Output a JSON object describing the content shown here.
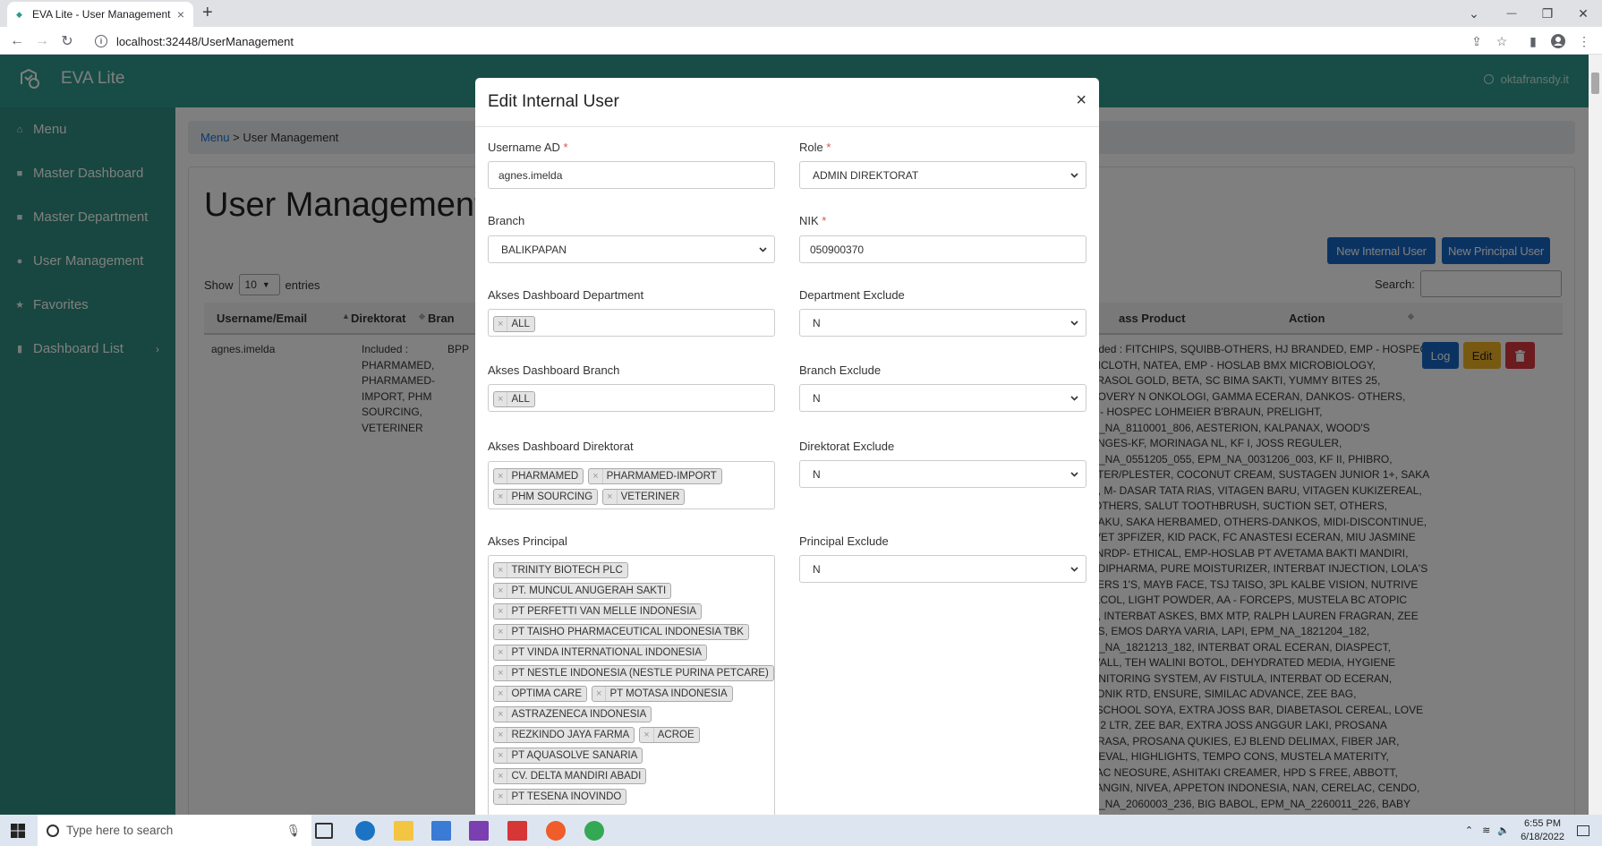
{
  "browser": {
    "tab_title": "EVA Lite - User Management",
    "tab_close": "×",
    "new_tab": "+",
    "url": "localhost:32448/UserManagement",
    "nav_back": "←",
    "nav_forward": "→",
    "nav_reload": "↻",
    "win_chevron": "⌄",
    "win_min": "—",
    "win_restore": "❐",
    "win_close": "✕"
  },
  "app": {
    "brand": "EVA Lite",
    "user": "oktafransdy.it",
    "accent_color": "#2e9b8c"
  },
  "sidebar": {
    "items": [
      {
        "label": "Menu",
        "icon": "home-icon",
        "glyph": "⌂"
      },
      {
        "label": "Master Dashboard",
        "icon": "database-icon",
        "glyph": "■"
      },
      {
        "label": "Master Department",
        "icon": "database-icon",
        "glyph": "■"
      },
      {
        "label": "User Management",
        "icon": "user-icon",
        "glyph": "●"
      },
      {
        "label": "Favorites",
        "icon": "star-icon",
        "glyph": "★"
      },
      {
        "label": "Dashboard List",
        "icon": "file-icon",
        "glyph": "▮",
        "arrow": "›"
      }
    ]
  },
  "breadcrumb": {
    "root": "Menu",
    "sep": " > ",
    "current": "User Management"
  },
  "page": {
    "title": "User Management",
    "new_internal_label": "New Internal User",
    "new_principal_label": "New Principal User",
    "show_label": "Show",
    "entries_value": "10",
    "entries_label": "entries",
    "search_label": "Search:"
  },
  "table": {
    "headers": {
      "username": "Username/Email",
      "direktorat": "Direktorat",
      "branch": "Bran",
      "product": "ass Product",
      "action": "Action"
    },
    "row": {
      "username": "agnes.imelda",
      "direktorat": [
        "Included :",
        "PHARMAMED,",
        "PHARMAMED-",
        "IMPORT, PHM",
        "SOURCING,",
        "VETERINER"
      ],
      "branch": "BPP",
      "product": [
        "luded : FITCHIPS, SQUIBB-OTHERS, HJ BRANDED, EMP - HOSPEC",
        "DICLOTH, NATEA, EMP - HOSLAB BMX MICROBIOLOGY,",
        "TRASOL GOLD, BETA, SC BIMA SAKTI, YUMMY BITES 25,",
        "COVERY N ONKOLOGI, GAMMA ECERAN, DANKOS- OTHERS,",
        "P - HOSPEC LOHMEIER B'BRAUN, PRELIGHT,",
        "M_NA_8110001_806, AESTERION, KALPANAX, WOOD'S",
        "ENGES-KF, MORINAGA NL, KF I, JOSS REGULER,",
        "M_NA_0551205_055, EPM_NA_0031206_003, KF II, PHIBRO,",
        "STER/PLESTER, COCONUT CREAM, SUSTAGEN JUNIOR 1+, SAKA",
        "N, M- DASAR TATA RIAS, VITAGEN BARU, VITAGEN KUKIZEREAL,",
        "-OTHERS, SALUT TOOTHBRUSH, SUCTION SET, OTHERS,",
        "DAKU, SAKA HERBAMED, OTHERS-DANKOS, MIDI-DISCONTINUE,",
        "-VET 3PFIZER, KID PACK, FC ANASTESI ECERAN, MIU JASMINE",
        ", NRDP- ETHICAL, EMP-HOSLAB PT AVETAMA BAKTI MANDIRI,",
        "NDIPHARMA, PURE MOISTURIZER, INTERBAT INJECTION, LOLA'S",
        "PERS 1'S, MAYB FACE, TSJ TAISO, 3PL KALBE VISION, NUTRIVE",
        "IECOL, LIGHT POWDER, AA - FORCEPS, MUSTELA BC ATOPIC",
        "N, INTERBAT ASKES, BMX MTP, RALPH LAUREN FRAGRAN, ZEE",
        "DS, EMOS DARYA VARIA, LAPI, EPM_NA_1821204_182,",
        "M_NA_1821213_182, INTERBAT ORAL ECERAN, DIASPECT,",
        "WALL, TEH WALINI BOTOL, DEHYDRATED MEDIA, HYGIENE",
        "ONITORING SYSTEM, AV FISTULA, INTERBAT OD ECERAN,",
        "TONIK RTD, ENSURE, SIMILAC ADVANCE, ZEE BAG,",
        "LSCHOOL SOYA, EXTRA JOSS BAR, DIABETASOL CEREAL, LOVE",
        "E 2 LTR, ZEE BAR, EXTRA JOSS ANGGUR LAKI, PROSANA",
        "ARASA, PROSANA QUKIES, EJ BLEND DELIMAX, FIBER JAR,",
        "GEVAL, HIGHLIGHTS, TEMPO CONS, MUSTELA MATERITY,",
        "LAC NEOSURE, ASHITAKI CREAMER, HPD S FREE, ABBOTT,",
        "TANGIN, NIVEA, APPETON INDONESIA, NAN, CERELAC, CENDO,",
        "M_NA_2060003_236, BIG BABOL, EPM_NA_2260011_226, BABY"
      ],
      "log_label": "Log",
      "edit_label": "Edit"
    }
  },
  "modal": {
    "title": "Edit Internal User",
    "close": "×",
    "username_label": "Username AD",
    "username_value": "agnes.imelda",
    "role_label": "Role",
    "role_value": "ADMIN DIREKTORAT",
    "branch_label": "Branch",
    "branch_value": "BALIKPAPAN",
    "nik_label": "NIK",
    "nik_value": "050900370",
    "required_mark": "*",
    "akses_dept_label": "Akses Dashboard Department",
    "akses_dept_chips": [
      "ALL"
    ],
    "dept_exclude_label": "Department Exclude",
    "dept_exclude_value": "N",
    "akses_branch_label": "Akses Dashboard Branch",
    "akses_branch_chips": [
      "ALL"
    ],
    "branch_exclude_label": "Branch Exclude",
    "branch_exclude_value": "N",
    "akses_dir_label": "Akses Dashboard Direktorat",
    "akses_dir_chips": [
      "PHARMAMED",
      "PHARMAMED-IMPORT",
      "PHM SOURCING",
      "VETERINER"
    ],
    "dir_exclude_label": "Direktorat Exclude",
    "dir_exclude_value": "N",
    "akses_principal_label": "Akses Principal",
    "akses_principal_chips": [
      "TRINITY BIOTECH PLC",
      "PT. MUNCUL ANUGERAH SAKTI",
      "PT PERFETTI VAN MELLE INDONESIA",
      "PT TAISHO PHARMACEUTICAL INDONESIA TBK",
      "PT VINDA INTERNATIONAL INDONESIA",
      "PT NESTLE INDONESIA (NESTLE PURINA PETCARE)",
      "OPTIMA CARE",
      "PT MOTASA INDONESIA",
      "ASTRAZENECA INDONESIA",
      "REZKINDO JAYA FARMA",
      "ACROE",
      "PT AQUASOLVE SANARIA",
      "CV. DELTA MANDIRI ABADI",
      "PT TESENA INOVINDO"
    ],
    "principal_exclude_label": "Principal Exclude",
    "principal_exclude_value": "N",
    "chip_remove": "×"
  },
  "taskbar": {
    "search_placeholder": "Type here to search",
    "time": "6:55 PM",
    "date": "6/18/2022"
  }
}
